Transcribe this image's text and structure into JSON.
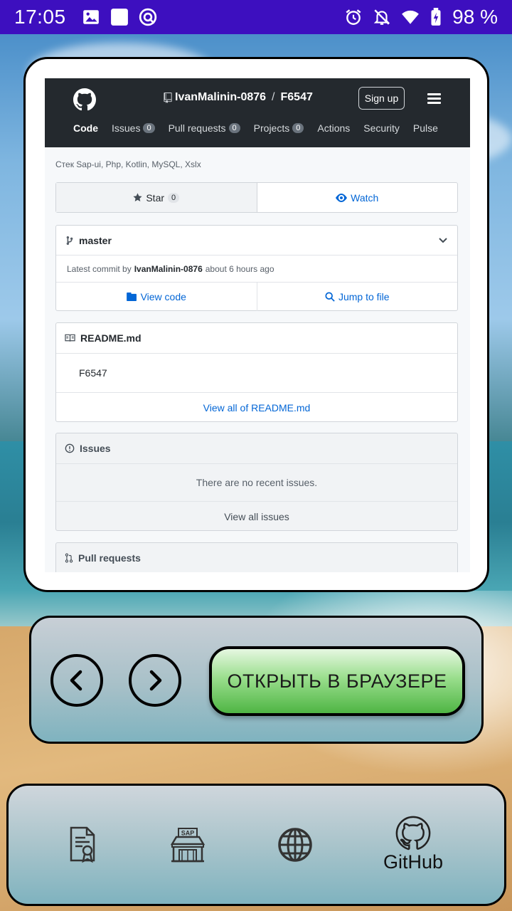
{
  "status_bar": {
    "time": "17:05",
    "battery": "98 %",
    "icons": [
      "image-icon",
      "square-icon",
      "q-app-icon",
      "alarm-icon",
      "mute-icon",
      "wifi-icon",
      "battery-charging-icon"
    ]
  },
  "github": {
    "owner": "IvanMalinin-0876",
    "separator": "/",
    "repo": "F6547",
    "signup_label": "Sign up",
    "nav": [
      {
        "label": "Code",
        "count": null
      },
      {
        "label": "Issues",
        "count": "0"
      },
      {
        "label": "Pull requests",
        "count": "0"
      },
      {
        "label": "Projects",
        "count": "0"
      },
      {
        "label": "Actions",
        "count": null
      },
      {
        "label": "Security",
        "count": null
      },
      {
        "label": "Pulse",
        "count": null
      }
    ],
    "description": "Стек Sap-ui, Php, Kotlin, MySQL, Xslx",
    "star_label": "Star",
    "star_count": "0",
    "watch_label": "Watch",
    "branch": "master",
    "commit_prefix": "Latest commit by",
    "commit_author": "IvanMalinin-0876",
    "commit_time": "about 6 hours ago",
    "view_code_label": "View code",
    "jump_label": "Jump to file",
    "readme_title": "README.md",
    "readme_body": "F6547",
    "readme_link": "View all of README.md",
    "issues_title": "Issues",
    "issues_empty": "There are no recent issues.",
    "issues_link": "View all issues",
    "pulls_title": "Pull requests"
  },
  "controls": {
    "back_icon": "chevron-left-icon",
    "forward_icon": "chevron-right-icon",
    "open_browser_label": "ОТКРЫТЬ В БРАУЗЕРЕ"
  },
  "bottom_nav": {
    "tabs": [
      {
        "icon": "certificate-icon",
        "label": ""
      },
      {
        "icon": "sap-store-icon",
        "label": ""
      },
      {
        "icon": "globe-icon",
        "label": ""
      },
      {
        "icon": "github-icon",
        "label": "GitHub"
      }
    ],
    "selected": "GitHub"
  }
}
